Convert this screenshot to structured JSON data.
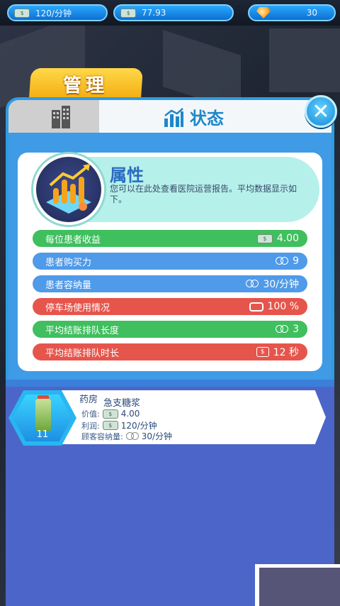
{
  "top_bar": {
    "income_rate": "120/分钟",
    "money": "77.93",
    "gems": "30",
    "cash_icon_text": "$"
  },
  "manage_tab": {
    "label": "管理"
  },
  "tabs": {
    "building_icon": "building-icon",
    "status_label": "状态"
  },
  "close_button": {
    "label": "✕"
  },
  "attributes": {
    "title": "属性",
    "description": "您可以在此处查看医院运营报告。平均数据显示如下。"
  },
  "stats": [
    {
      "label": "每位患者收益",
      "value": "4.00",
      "icon": "cash-icon",
      "color": "green"
    },
    {
      "label": "患者购买力",
      "value": "9",
      "icon": "people-icon",
      "color": "blue"
    },
    {
      "label": "患者容纳量",
      "value": "30/分钟",
      "icon": "people-icon",
      "color": "blue"
    },
    {
      "label": "停车场使用情况",
      "value": "100 %",
      "icon": "car-icon",
      "color": "red"
    },
    {
      "label": "平均结账排队长度",
      "value": "3",
      "icon": "people-icon",
      "color": "green"
    },
    {
      "label": "平均结账排队时长",
      "value": "12 秒",
      "icon": "timer-cash-icon",
      "color": "red"
    }
  ],
  "item": {
    "category": "药房",
    "name": "急支糖浆",
    "level": "11",
    "price_label": "价值:",
    "price_value": "4.00",
    "profit_label": "利润:",
    "profit_value": "120/分钟",
    "capacity_label": "顾客容纳量:",
    "capacity_value": "30/分钟"
  },
  "colors": {
    "green": "#3fbf5e",
    "blue": "#4f9ae9",
    "red": "#e6554c",
    "accent": "#1d88c9"
  }
}
